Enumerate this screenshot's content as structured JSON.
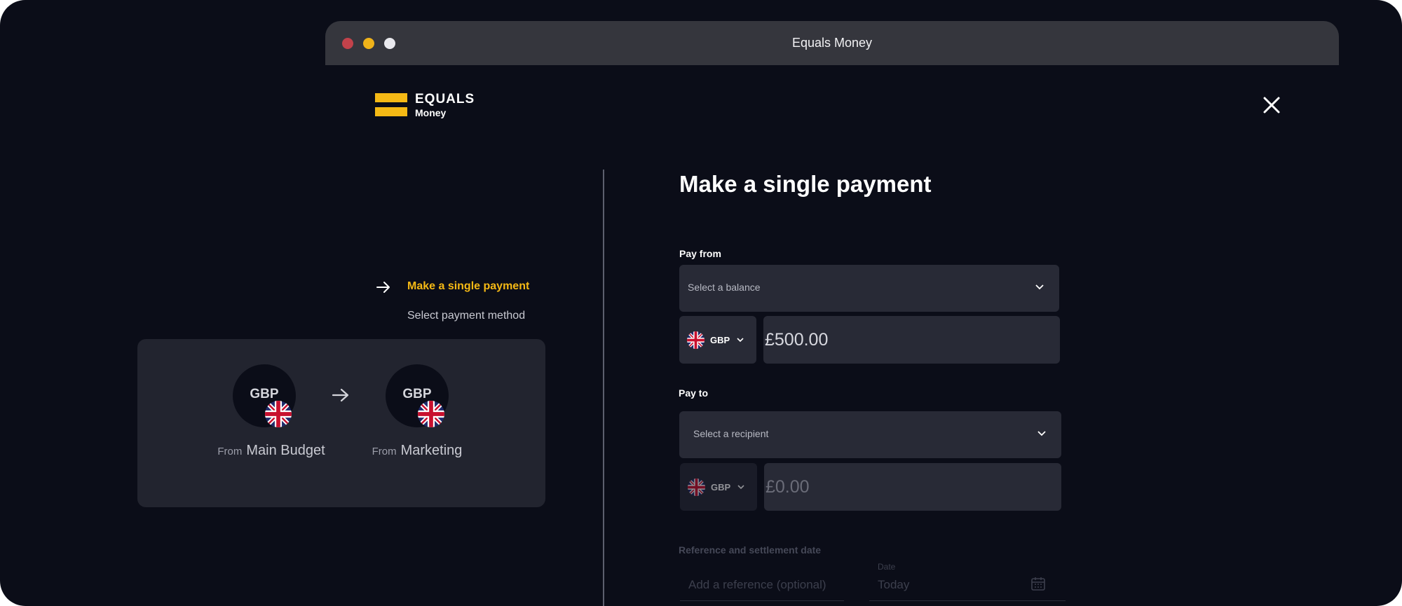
{
  "window": {
    "title": "Equals Money"
  },
  "brand": {
    "name": "EQUALS",
    "sub": "Money",
    "accent_color": "#f5b915"
  },
  "steps": {
    "active": "Make a single payment",
    "next": "Select payment method"
  },
  "summary": {
    "from_currency": "GBP",
    "to_currency": "GBP",
    "from_prefix": "From",
    "from_account": "Main Budget",
    "to_prefix": "From",
    "to_account": "Marketing",
    "flag_icon": "uk-flag-icon"
  },
  "form": {
    "title": "Make a single payment",
    "pay_from": {
      "label": "Pay from",
      "placeholder": "Select a balance",
      "currency": "GBP",
      "amount": "£500.00"
    },
    "pay_to": {
      "label": "Pay to",
      "placeholder": "Select a recipient",
      "currency": "GBP",
      "amount": "£0.00"
    },
    "reference": {
      "section_label": "Reference and settlement date",
      "placeholder": "Add a reference (optional)",
      "date_label": "Date",
      "date_value": "Today"
    }
  }
}
